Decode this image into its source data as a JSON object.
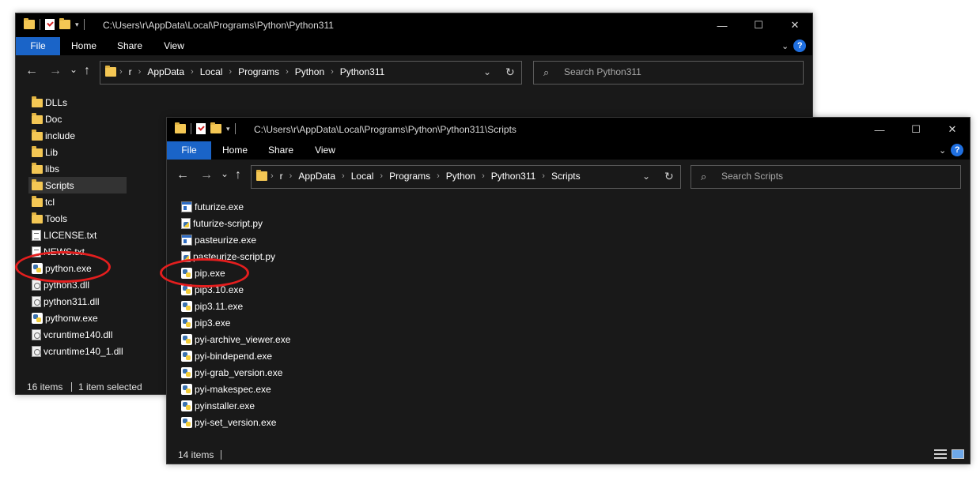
{
  "colors": {
    "accent_file_tab": "#1a64c8",
    "window_bg": "#191919",
    "callout": "#e41e1e",
    "folder": "#f4c754"
  },
  "back_window": {
    "title_path": "C:\\Users\\r\\AppData\\Local\\Programs\\Python\\Python311",
    "ribbon_tabs": [
      "File",
      "Home",
      "Share",
      "View"
    ],
    "breadcrumbs": [
      "r",
      "AppData",
      "Local",
      "Programs",
      "Python",
      "Python311"
    ],
    "search_placeholder": "Search Python311",
    "items": [
      {
        "name": "DLLs",
        "icon": "folder-icon"
      },
      {
        "name": "Doc",
        "icon": "folder-icon"
      },
      {
        "name": "include",
        "icon": "folder-icon"
      },
      {
        "name": "Lib",
        "icon": "folder-icon"
      },
      {
        "name": "libs",
        "icon": "folder-icon"
      },
      {
        "name": "Scripts",
        "icon": "folder-icon",
        "selected": true
      },
      {
        "name": "tcl",
        "icon": "folder-icon"
      },
      {
        "name": "Tools",
        "icon": "folder-icon"
      },
      {
        "name": "LICENSE.txt",
        "icon": "text-file-icon"
      },
      {
        "name": "NEWS.txt",
        "icon": "text-file-icon"
      },
      {
        "name": "python.exe",
        "icon": "python-icon"
      },
      {
        "name": "python3.dll",
        "icon": "dll-file-icon"
      },
      {
        "name": "python311.dll",
        "icon": "dll-file-icon"
      },
      {
        "name": "pythonw.exe",
        "icon": "python-icon"
      },
      {
        "name": "vcruntime140.dll",
        "icon": "dll-file-icon"
      },
      {
        "name": "vcruntime140_1.dll",
        "icon": "dll-file-icon"
      }
    ],
    "status": {
      "count": "16 items",
      "selection": "1 item selected"
    }
  },
  "front_window": {
    "title_path": "C:\\Users\\r\\AppData\\Local\\Programs\\Python\\Python311\\Scripts",
    "ribbon_tabs": [
      "File",
      "Home",
      "Share",
      "View"
    ],
    "breadcrumbs": [
      "r",
      "AppData",
      "Local",
      "Programs",
      "Python",
      "Python311",
      "Scripts"
    ],
    "search_placeholder": "Search Scripts",
    "items": [
      {
        "name": "futurize.exe",
        "icon": "exe-file-icon"
      },
      {
        "name": "futurize-script.py",
        "icon": "python-script-icon"
      },
      {
        "name": "pasteurize.exe",
        "icon": "exe-file-icon"
      },
      {
        "name": "pasteurize-script.py",
        "icon": "python-script-icon"
      },
      {
        "name": "pip.exe",
        "icon": "python-icon"
      },
      {
        "name": "pip3.10.exe",
        "icon": "python-icon"
      },
      {
        "name": "pip3.11.exe",
        "icon": "python-icon"
      },
      {
        "name": "pip3.exe",
        "icon": "python-icon"
      },
      {
        "name": "pyi-archive_viewer.exe",
        "icon": "python-icon"
      },
      {
        "name": "pyi-bindepend.exe",
        "icon": "python-icon"
      },
      {
        "name": "pyi-grab_version.exe",
        "icon": "python-icon"
      },
      {
        "name": "pyi-makespec.exe",
        "icon": "python-icon"
      },
      {
        "name": "pyinstaller.exe",
        "icon": "python-icon"
      },
      {
        "name": "pyi-set_version.exe",
        "icon": "python-icon"
      }
    ],
    "status": {
      "count": "14 items"
    }
  },
  "icons": {
    "back": "←",
    "forward": "→",
    "recent": "⌄",
    "up": "↑",
    "dropdown": "⌄",
    "refresh": "↻",
    "search": "⌕",
    "minimize": "—",
    "maximize": "☐",
    "close": "✕",
    "ribbon_expand": "⌄",
    "help": "?",
    "crumb_sep": "›",
    "qa_dropdown": "▾"
  }
}
